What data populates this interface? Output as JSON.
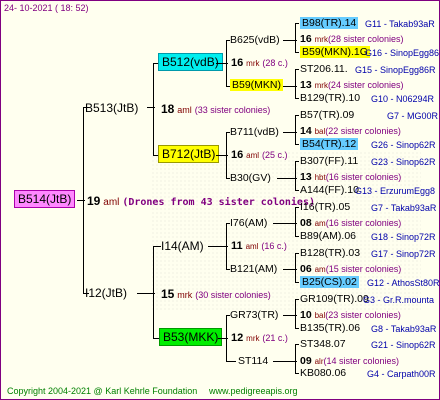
{
  "header": {
    "timestamp": "24- 10-2021 ( 18: 52)"
  },
  "footer": {
    "copyright": "Copyright 2004-2021 @ Karl Kehrle Foundation",
    "site": "www.pedigreeapis.org"
  },
  "root": {
    "label": "B514(JtB)",
    "num": "19",
    "mark": "aml",
    "note": "(Drones from 43 sister colonies)"
  },
  "gen1": [
    {
      "label": "B513(JtB)",
      "num": "18",
      "mark": "aml",
      "note": "(33 sister colonies)"
    },
    {
      "label": "I12(JtB)",
      "num": "15",
      "mark": "mrk",
      "note": "(30 sister colonies)"
    }
  ],
  "gen2": [
    {
      "label": "B512(vdB)",
      "num": "16",
      "mark": "mrk",
      "note": "(28 c.)"
    },
    {
      "label": "B712(JtB)",
      "num": "16",
      "mark": "aml",
      "note": "(25 c.)"
    },
    {
      "label": "I14(AM)",
      "num": "11",
      "mark": "aml",
      "note": "(16 c.)"
    },
    {
      "label": "B53(MKK)",
      "num": "12",
      "mark": "mrk",
      "note": "(21 c.)"
    }
  ],
  "gen3": [
    {
      "label": "B625(vdB)",
      "num": "16",
      "mark": "mrk",
      "note": "(28 sister colonies)"
    },
    {
      "label": "B59(MKN)",
      "num": "13",
      "mark": "mrk",
      "note": "(24 sister colonies)"
    },
    {
      "label": "B711(vdB)",
      "num": "14",
      "mark": "bal",
      "note": "(22 sister colonies)"
    },
    {
      "label": "B30(GV)",
      "num": "13",
      "mark": "hbt",
      "note": "(16 sister colonies)"
    },
    {
      "label": "I76(AM)",
      "num": "08",
      "mark": "am",
      "note": "(16 sister colonies)"
    },
    {
      "label": "B121(AM)",
      "num": "06",
      "mark": "am",
      "note": "(15 sister colonies)"
    },
    {
      "label": "GR73(TR)",
      "num": "10",
      "mark": "bal",
      "note": "(23 sister colonies)"
    },
    {
      "label": "ST114",
      "num": "09",
      "mark": "alr",
      "note": "(14 sister colonies)"
    }
  ],
  "gen4": [
    {
      "name": "B98(TR).14",
      "rank": "G11 - Takab93aR"
    },
    {
      "name": "B59(MKN).1G",
      "rank": "G16 - SinopEgg86R"
    },
    {
      "name": "ST206.11.",
      "rank": "G15 - SinopEgg86R"
    },
    {
      "name": "B129(TR).10",
      "rank": "G10 - N06294R"
    },
    {
      "name": "B57(TR).09",
      "rank": "G7 - MG00R"
    },
    {
      "name": "B54(TR).12",
      "rank": "G26 - Sinop62R"
    },
    {
      "name": "B307(FF).11",
      "rank": "G23 - Sinop62R"
    },
    {
      "name": "A144(FF).10",
      "rank": "G13 - ErzurumEgg8"
    },
    {
      "name": "I16(TR).05",
      "rank": "G7 - Takab93aR"
    },
    {
      "name": "B89(AM).06",
      "rank": "G18 - Sinop72R"
    },
    {
      "name": "B128(TR).03",
      "rank": "G17 - Sinop72R"
    },
    {
      "name": "B25(CS).02",
      "rank": "G12 - AthosSt80R"
    },
    {
      "name": "GR109(TR).09",
      "rank": "G3 - Gr.R.mounta"
    },
    {
      "name": "B135(TR).06",
      "rank": "G8 - Takab93aR"
    },
    {
      "name": "ST348.07",
      "rank": "G21 - Sinop62R"
    },
    {
      "name": "KB080.06",
      "rank": "G4 - Carpath00R"
    }
  ]
}
